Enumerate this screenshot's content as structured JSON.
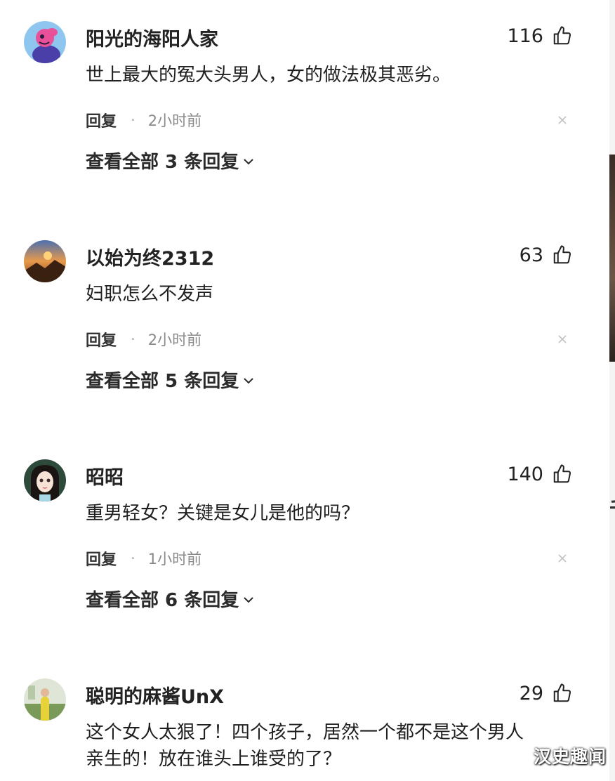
{
  "comments": [
    {
      "username": "阳光的海阳人家",
      "likes": "116",
      "content": "世上最大的冤大头男人，女的做法极其恶劣。",
      "reply_label": "回复",
      "separator": "·",
      "time": "2小时前",
      "view_replies": "查看全部 3 条回复",
      "avatar_icon": "pink-cartoon-avatar-icon"
    },
    {
      "username": "以始为终2312",
      "likes": "63",
      "content": "妇职怎么不发声",
      "reply_label": "回复",
      "separator": "·",
      "time": "2小时前",
      "view_replies": "查看全部 5 条回复",
      "avatar_icon": "sunset-photo-avatar-icon"
    },
    {
      "username": "昭昭",
      "likes": "140",
      "content": "重男轻女？关键是女儿是他的吗？",
      "reply_label": "回复",
      "separator": "·",
      "time": "1小时前",
      "view_replies": "查看全部 6 条回复",
      "avatar_icon": "anime-girl-avatar-icon"
    },
    {
      "username": "聪明的麻酱UnX",
      "likes": "29",
      "content_lines": [
        "这个女人太狠了！四个孩子，居然一个都不是这个男人",
        "亲生的！放在谁头上谁受的了？"
      ],
      "avatar_icon": "outdoor-person-avatar-icon"
    }
  ],
  "icons": {
    "like": "thumbs-up-icon",
    "dismiss": "close-icon",
    "expand": "chevron-down-icon"
  },
  "watermark": "汉史趣闻",
  "edge_fragment": "千",
  "colors": {
    "text": "#1f1f1f",
    "meta": "#8a8a8a",
    "dismiss": "#c2c2c2"
  }
}
